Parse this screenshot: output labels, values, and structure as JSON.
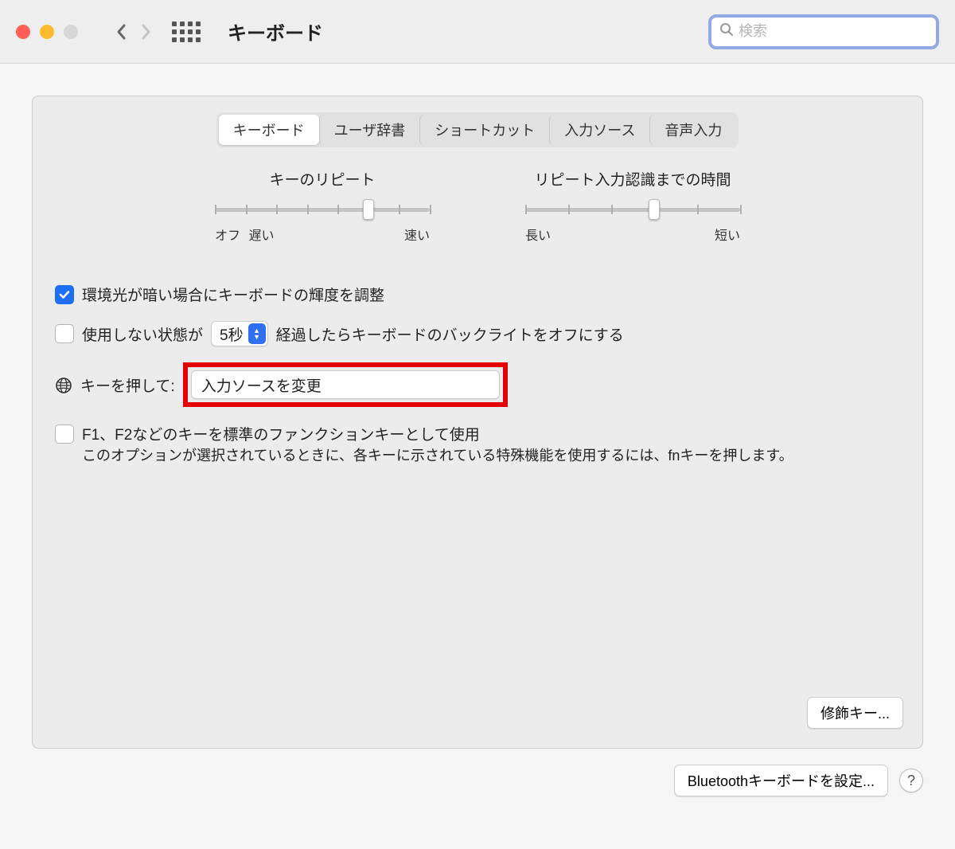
{
  "toolbar": {
    "title": "キーボード",
    "search_placeholder": "検索"
  },
  "tabs": [
    "キーボード",
    "ユーザ辞書",
    "ショートカット",
    "入力ソース",
    "音声入力"
  ],
  "sliders": {
    "repeat": {
      "label": "キーのリピート",
      "left_a": "オフ",
      "left_b": "遅い",
      "right": "速い"
    },
    "delay": {
      "label": "リピート入力認識までの時間",
      "left": "長い",
      "right": "短い"
    }
  },
  "options": {
    "adjust_brightness": "環境光が暗い場合にキーボードの輝度を調整",
    "idle_prefix": "使用しない状態が",
    "idle_value": "5秒",
    "idle_suffix": "経過したらキーボードのバックライトをオフにする",
    "globe_label": "キーを押して:",
    "globe_value": "入力ソースを変更",
    "fn_label": "F1、F2などのキーを標準のファンクションキーとして使用",
    "fn_desc": "このオプションが選択されているときに、各キーに示されている特殊機能を使用するには、fnキーを押します。"
  },
  "buttons": {
    "modifier": "修飾キー...",
    "bluetooth": "Bluetoothキーボードを設定...",
    "help": "?"
  }
}
